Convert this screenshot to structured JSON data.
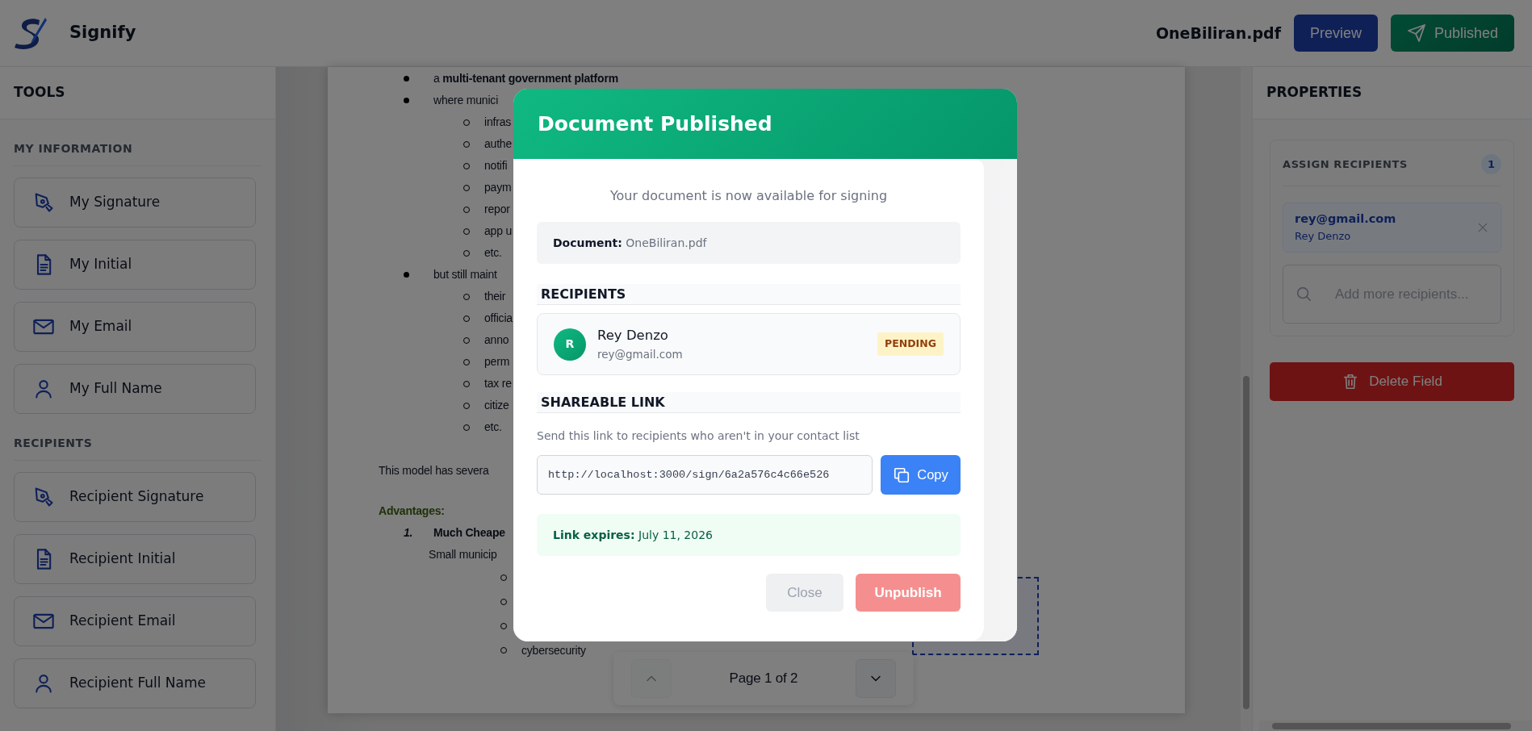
{
  "header": {
    "app_name": "Signify",
    "file_name": "OneBiliran.pdf",
    "buttons": [
      {
        "label": "Preview",
        "kind": "preview"
      },
      {
        "label": "Published",
        "kind": "publish"
      }
    ]
  },
  "tools": {
    "title": "TOOLS",
    "sections": [
      {
        "title": "MY INFORMATION",
        "items": [
          {
            "label": "My Signature",
            "kind": "signature"
          },
          {
            "label": "My Initial",
            "kind": "initial"
          },
          {
            "label": "My Email",
            "kind": "email"
          },
          {
            "label": "My Full Name",
            "kind": "name"
          }
        ]
      },
      {
        "title": "RECIPIENTS",
        "items": [
          {
            "label": "Recipient Signature",
            "kind": "signature"
          },
          {
            "label": "Recipient Initial",
            "kind": "initial"
          },
          {
            "label": "Recipient Email",
            "kind": "email"
          },
          {
            "label": "Recipient Full Name",
            "kind": "name"
          }
        ]
      }
    ]
  },
  "document": {
    "lines": [
      {
        "kind": "bullet",
        "text": "a **multi-tenant government platform**"
      },
      {
        "kind": "bullet",
        "text": "where munici"
      },
      {
        "kind": "sub",
        "text": "infras"
      },
      {
        "kind": "sub",
        "text": "authe"
      },
      {
        "kind": "sub",
        "text": "notifi"
      },
      {
        "kind": "sub",
        "text": "paym"
      },
      {
        "kind": "sub",
        "text": "repor"
      },
      {
        "kind": "sub",
        "text": "app u"
      },
      {
        "kind": "sub",
        "text": "etc."
      },
      {
        "kind": "bullet",
        "text": "but still maint"
      },
      {
        "kind": "sub",
        "text": "their"
      },
      {
        "kind": "sub",
        "text": "officia"
      },
      {
        "kind": "sub",
        "text": "anno"
      },
      {
        "kind": "sub",
        "text": "perm"
      },
      {
        "kind": "sub",
        "text": "tax re"
      },
      {
        "kind": "sub",
        "text": "citize"
      },
      {
        "kind": "sub",
        "text": "etc."
      },
      {
        "kind": "para",
        "text": "This model has severa"
      },
      {
        "kind": "heading",
        "text": "Advantages:"
      },
      {
        "kind": "numbered",
        "marker": "1.",
        "text": "Much Cheape"
      },
      {
        "kind": "indent",
        "text": "Small municip"
      },
      {
        "kind": "deep"
      },
      {
        "kind": "deep"
      },
      {
        "kind": "deep"
      },
      {
        "kind": "deep",
        "text": "cybersecurity"
      }
    ]
  },
  "pagination": {
    "label": "Page 1 of 2",
    "buttons": [
      {
        "kind": "prev",
        "disabled": true
      },
      {
        "kind": "next",
        "disabled": false
      }
    ]
  },
  "properties": {
    "title": "PROPERTIES",
    "assign_title": "ASSIGN RECIPIENTS",
    "count": "1",
    "recipients": [
      {
        "email": "rey@gmail.com",
        "name": "Rey Denzo"
      }
    ],
    "placeholder": "Add more recipients...",
    "delete_label": "Delete Field"
  },
  "modal": {
    "title": "Document Published",
    "subtitle": "Your document is now available for signing",
    "document_line": "**Document:** OneBiliran.pdf",
    "recipients_heading": "RECIPIENTS",
    "recipients": [
      {
        "initial": "R",
        "name": "Rey Denzo",
        "email": "rey@gmail.com",
        "status": "PENDING"
      }
    ],
    "link_heading": "SHAREABLE LINK",
    "link_hint": "Send this link to recipients who aren't in your contact list",
    "link": "http://localhost:3000/sign/6a2a576c4c66e526",
    "copy_label": "Copy",
    "expires_line": "**Link expires:** July 11, 2026",
    "buttons": [
      {
        "label": "Close",
        "kind": "secondary"
      },
      {
        "label": "Unpublish",
        "kind": "danger"
      }
    ]
  }
}
